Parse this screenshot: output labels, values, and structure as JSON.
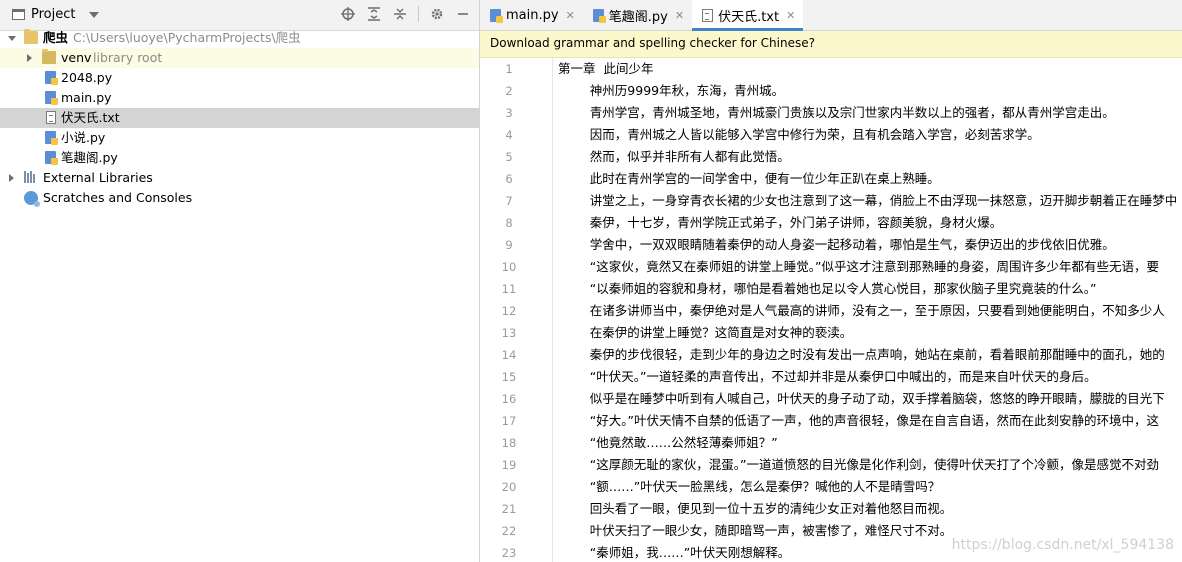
{
  "left_panel": {
    "title": "Project",
    "tree": [
      {
        "label": "爬虫",
        "extra": "C:\\Users\\luoye\\PycharmProjects\\爬虫"
      },
      {
        "label": "venv",
        "extra": "library root"
      },
      {
        "label": "2048.py"
      },
      {
        "label": "main.py"
      },
      {
        "label": "伏天氏.txt"
      },
      {
        "label": "小说.py"
      },
      {
        "label": "笔趣阁.py"
      },
      {
        "label": "External Libraries"
      },
      {
        "label": "Scratches and Consoles"
      }
    ]
  },
  "tabs": [
    {
      "label": "main.py",
      "icon": "python-file-icon"
    },
    {
      "label": "笔趣阁.py",
      "icon": "python-file-icon"
    },
    {
      "label": "伏天氏.txt",
      "icon": "text-file-icon"
    }
  ],
  "banner": "Download grammar and spelling checker for Chinese?",
  "line_numbers": [
    "1",
    "2",
    "3",
    "4",
    "5",
    "6",
    "7",
    "8",
    "9",
    "10",
    "11",
    "12",
    "13",
    "14",
    "15",
    "16",
    "17",
    "18",
    "19",
    "20",
    "21",
    "22",
    "23"
  ],
  "lines": [
    "第一章  此间少年",
    "        神州历9999年秋，东海，青州城。",
    "        青州学宫，青州城圣地，青州城豪门贵族以及宗门世家内半数以上的强者，都从青州学宫走出。",
    "        因而，青州城之人皆以能够入学宫中修行为荣，且有机会踏入学宫，必刻苦求学。",
    "        然而，似乎并非所有人都有此觉悟。",
    "        此时在青州学宫的一间学舍中，便有一位少年正趴在桌上熟睡。",
    "        讲堂之上，一身穿青衣长裙的少女也注意到了这一幕，俏脸上不由浮现一抹怒意，迈开脚步朝着正在睡梦中",
    "        秦伊，十七岁，青州学院正式弟子，外门弟子讲师，容颜美貌，身材火爆。",
    "        学舍中，一双双眼睛随着秦伊的动人身姿一起移动着，哪怕是生气，秦伊迈出的步伐依旧优雅。",
    "        “这家伙，竟然又在秦师姐的讲堂上睡觉。”似乎这才注意到那熟睡的身姿，周围许多少年都有些无语，要",
    "        “以秦师姐的容貌和身材，哪怕是看着她也足以令人赏心悦目，那家伙脑子里究竟装的什么。”",
    "        在诸多讲师当中，秦伊绝对是人气最高的讲师，没有之一，至于原因，只要看到她便能明白，不知多少人",
    "        在秦伊的讲堂上睡觉？这简直是对女神的亵渎。",
    "        秦伊的步伐很轻，走到少年的身边之时没有发出一点声响，她站在桌前，看着眼前那酣睡中的面孔，她的",
    "        “叶伏天。”一道轻柔的声音传出，不过却并非是从秦伊口中喊出的，而是来自叶伏天的身后。",
    "        似乎是在睡梦中听到有人喊自己，叶伏天的身子动了动，双手撑着脑袋，悠悠的睁开眼睛，朦胧的目光下",
    "        “好大。”叶伏天情不自禁的低语了一声，他的声音很轻，像是在自言自语，然而在此刻安静的环境中，这",
    "        “他竟然敢……公然轻薄秦师姐？”",
    "        “这厚颜无耻的家伙，混蛋。”一道道愤怒的目光像是化作利剑，使得叶伏天打了个冷颤，像是感觉不对劲",
    "        “额……”叶伏天一脸黑线，怎么是秦伊？喊他的人不是晴雪吗？",
    "        回头看了一眼，便见到一位十五岁的清纯少女正对着他怒目而视。",
    "        叶伏天扫了一眼少女，随即暗骂一声，被害惨了，难怪尺寸不对。",
    "        “秦师姐，我……”叶伏天刚想解释。"
  ],
  "watermark": "https://blog.csdn.net/xl_594138"
}
